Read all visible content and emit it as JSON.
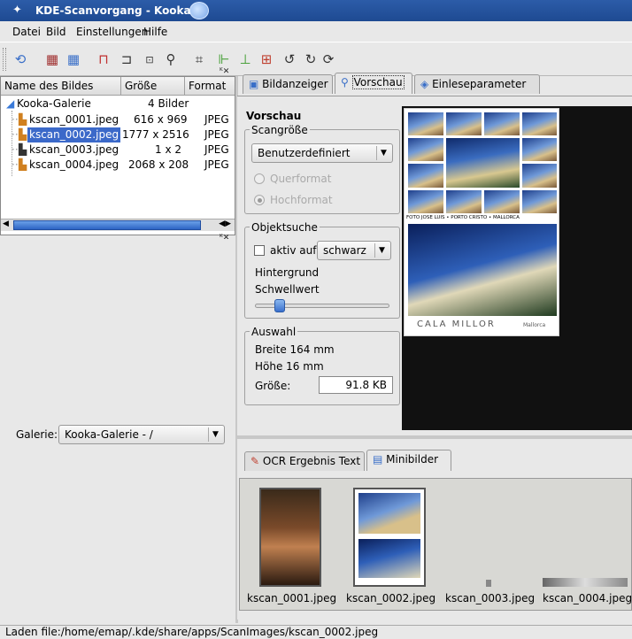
{
  "window": {
    "title": "KDE-Scanvorgang - Kooka"
  },
  "menu": [
    "Datei",
    "Bild",
    "Einstellungen",
    "Hilfe"
  ],
  "gallery": {
    "columns": [
      "Name des Bildes",
      "Größe",
      "Format"
    ],
    "root": {
      "name": "Kooka-Galerie",
      "count": "4 Bilder"
    },
    "items": [
      {
        "name": "kscan_0001.jpeg",
        "size": "616 x 969",
        "format": "JPEG"
      },
      {
        "name": "kscan_0002.jpeg",
        "size": "1777 x 2516",
        "format": "JPEG"
      },
      {
        "name": "kscan_0003.jpeg",
        "size": "1 x 2",
        "format": "JPEG"
      },
      {
        "name": "kscan_0004.jpeg",
        "size": "2068 x 208",
        "format": "JPEG"
      }
    ],
    "galerie_label": "Galerie:",
    "galerie_value": "Kooka-Galerie - /"
  },
  "tabs": [
    "Bildanzeiger",
    "Vorschau",
    "Einleseparameter"
  ],
  "vorschau": {
    "heading": "Vorschau",
    "scangroesse": {
      "title": "Scangröße",
      "value": "Benutzerdefiniert",
      "quer": "Querformat",
      "hoch": "Hochformat"
    },
    "objektsuche": {
      "title": "Objektsuche",
      "aktiv": "aktiv auf",
      "farbe": "schwarz",
      "hintergrund": "Hintergrund",
      "schwellwert": "Schwellwert"
    },
    "auswahl": {
      "title": "Auswahl",
      "breite": "Breite 164 mm",
      "hoehe": "Höhe 16 mm",
      "groesse_label": "Größe:",
      "groesse_value": "91.8 KB"
    }
  },
  "postcard": {
    "caption": "FOTO JOSE LUIS • PORTO CRISTO • MALLORCA",
    "title": "CALA MILLOR",
    "subtitle": "Mallorca"
  },
  "bottom_tabs": [
    "OCR Ergebnis Text",
    "Minibilder"
  ],
  "thumbnails": [
    "kscan_0001.jpeg",
    "kscan_0002.jpeg",
    "kscan_0003.jpeg",
    "kscan_0004.jpeg"
  ],
  "status": "Laden file:/home/emap/.kde/share/apps/ScanImages/kscan_0002.jpeg"
}
